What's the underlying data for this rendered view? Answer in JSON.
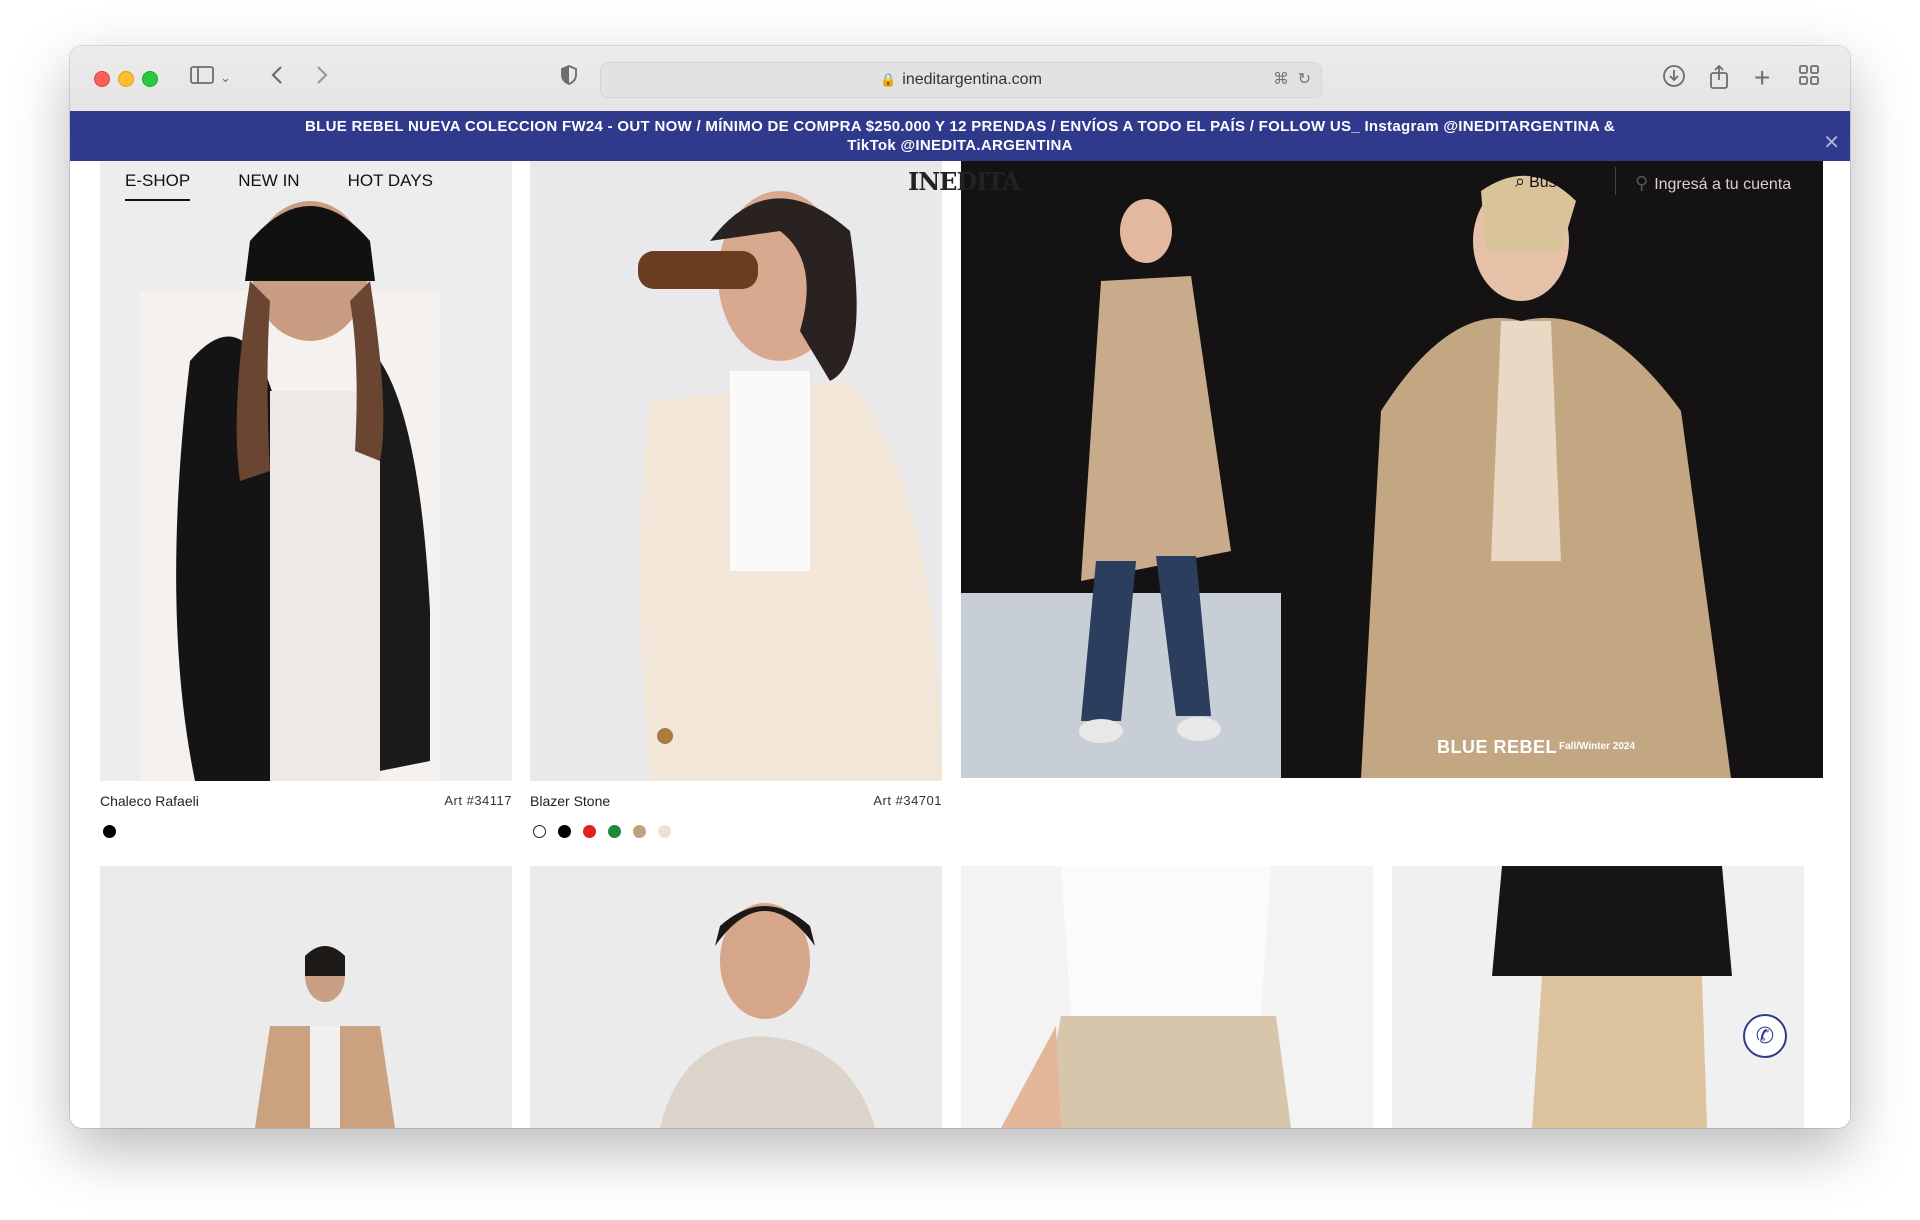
{
  "browser": {
    "url": "ineditargentina.com"
  },
  "announcement": {
    "line1": "BLUE REBEL NUEVA COLECCION FW24 - OUT NOW / MÍNIMO DE COMPRA $250.000 Y 12 PRENDAS / ENVÍOS A TODO EL PAÍS / FOLLOW US_  Instagram @INEDITARGENTINA &",
    "line2": "TikTok @INEDITA.ARGENTINA"
  },
  "nav": {
    "items": [
      {
        "label": "E-SHOP",
        "active": true
      },
      {
        "label": "NEW IN",
        "active": false
      },
      {
        "label": "HOT DAYS",
        "active": false
      }
    ]
  },
  "header": {
    "logo": "INEDITA",
    "search_label": "Buscar",
    "account_label": "Ingresá a tu cuenta"
  },
  "products": [
    {
      "name": "Chaleco Rafaeli",
      "art": "Art #34117",
      "swatches": [
        "#000000"
      ]
    },
    {
      "name": "Blazer Stone",
      "art": "Art #34701",
      "swatches": [
        "#ffffff",
        "#000000",
        "#e0211d",
        "#1d8a3b",
        "#c2a27a",
        "#ede0d6"
      ]
    }
  ],
  "hero": {
    "brand": "BLUE REBEL",
    "season": "Fall/Winter 2024"
  },
  "colors": {
    "announcement_bg": "#2f3a8d",
    "accent": "#2f3a8d"
  }
}
